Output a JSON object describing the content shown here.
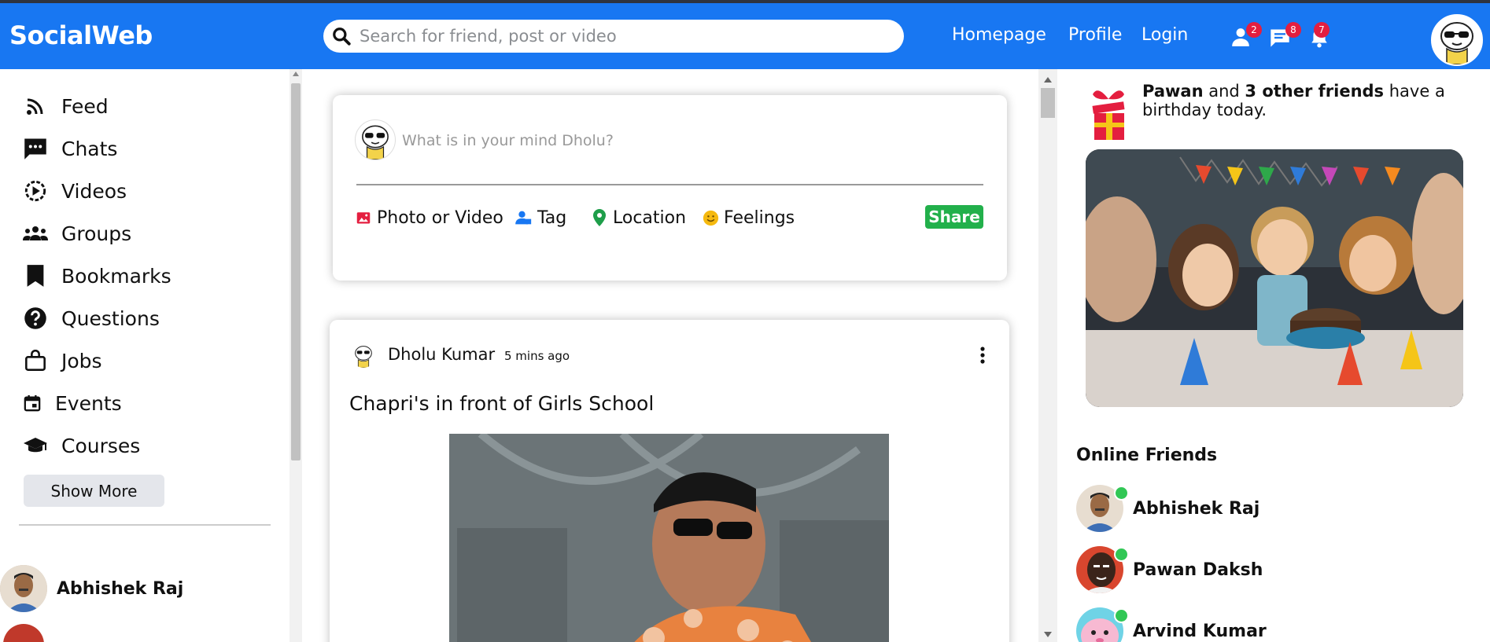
{
  "app": {
    "name": "SocialWeb"
  },
  "colors": {
    "topbar": "#1877f2",
    "online": "#31c755",
    "share_button": "#22b04b",
    "badge": "#e41e3f"
  },
  "search": {
    "placeholder": "Search for friend, post or video",
    "icon": "search-icon"
  },
  "nav": {
    "links": [
      "Homepage",
      "Profile",
      "Login"
    ]
  },
  "notifications": {
    "friends": {
      "icon": "person-icon",
      "count": "2"
    },
    "messages": {
      "icon": "chat-icon",
      "count": "8"
    },
    "alerts": {
      "icon": "bell-icon",
      "count": "7"
    }
  },
  "sidebar": {
    "items": [
      {
        "label": "Feed",
        "icon": "rss-icon"
      },
      {
        "label": "Chats",
        "icon": "chat-icon"
      },
      {
        "label": "Videos",
        "icon": "play-circle-icon"
      },
      {
        "label": "Groups",
        "icon": "group-icon"
      },
      {
        "label": "Bookmarks",
        "icon": "bookmark-icon"
      },
      {
        "label": "Questions",
        "icon": "question-icon"
      },
      {
        "label": "Jobs",
        "icon": "bag-icon"
      },
      {
        "label": "Events",
        "icon": "calendar-icon"
      },
      {
        "label": "Courses",
        "icon": "graduation-cap-icon"
      }
    ],
    "show_more": "Show More",
    "friends": [
      "Abhishek Raj"
    ]
  },
  "share": {
    "placeholder": "What is in your mind Dholu?",
    "options": [
      {
        "label": "Photo or Video",
        "icon": "photo-icon",
        "color": "#e41e3f"
      },
      {
        "label": "Tag",
        "icon": "tag-user-icon",
        "color": "#1877f2"
      },
      {
        "label": "Location",
        "icon": "location-pin-icon",
        "color": "#1e9e4a"
      },
      {
        "label": "Feelings",
        "icon": "smiley-icon",
        "color": "#f5b90f"
      }
    ],
    "button": "Share"
  },
  "post": {
    "author": "Dholu Kumar",
    "time": "5 mins ago",
    "text": "Chapri's in front of Girls School"
  },
  "rightbar": {
    "birthday": {
      "name": "Pawan",
      "middle": " and ",
      "others": "3 other friends",
      "suffix": " have a birthday today."
    },
    "online_title": "Online Friends",
    "online_friends": [
      "Abhishek Raj",
      "Pawan Daksh",
      "Arvind Kumar"
    ]
  }
}
